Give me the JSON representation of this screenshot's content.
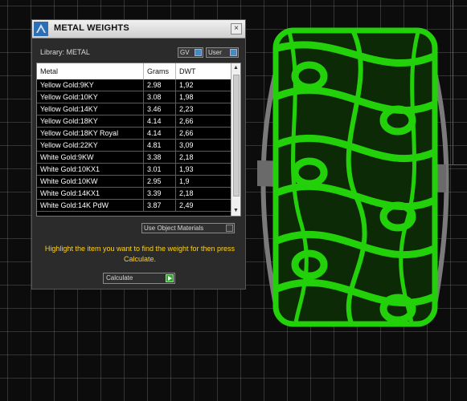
{
  "panel": {
    "title": "METAL WEIGHTS",
    "close_glyph": "×",
    "library_label": "Library: METAL",
    "toggles": [
      {
        "label": "GV",
        "state": "on"
      },
      {
        "label": "User",
        "state": "on"
      }
    ]
  },
  "table": {
    "headers": [
      "Metal",
      "Grams",
      "DWT"
    ],
    "rows": [
      [
        "Yellow Gold:9KY",
        "2.98",
        "1,92"
      ],
      [
        "Yellow Gold:10KY",
        "3.08",
        "1,98"
      ],
      [
        "Yellow Gold:14KY",
        "3.46",
        "2,23"
      ],
      [
        "Yellow Gold:18KY",
        "4.14",
        "2,66"
      ],
      [
        "Yellow Gold:18KY Royal",
        "4.14",
        "2,66"
      ],
      [
        "Yellow Gold:22KY",
        "4.81",
        "3,09"
      ],
      [
        "White Gold:9KW",
        "3.38",
        "2,18"
      ],
      [
        "White Gold:10KX1",
        "3.01",
        "1,93"
      ],
      [
        "White Gold:10KW",
        "2.95",
        "1,9"
      ],
      [
        "White Gold:14KX1",
        "3.39",
        "2,18"
      ],
      [
        "White Gold:14K PdW",
        "3.87",
        "2,49"
      ]
    ],
    "scroll_up_glyph": "▲",
    "scroll_down_glyph": "▼"
  },
  "use_object": {
    "label": "Use Object Materials"
  },
  "instructions": "Highlight the item you want to find the weight for then press Calculate.",
  "calculate": {
    "label": "Calculate"
  },
  "icons": {
    "app": "cad-app-icon",
    "close": "close-icon",
    "calculate": "play-arrow-icon"
  },
  "colors": {
    "ring_green": "#22d10a",
    "instruction_yellow": "#ffd21a",
    "toggle_blue": "#3d8fbf",
    "axis_red": "#d03030"
  }
}
